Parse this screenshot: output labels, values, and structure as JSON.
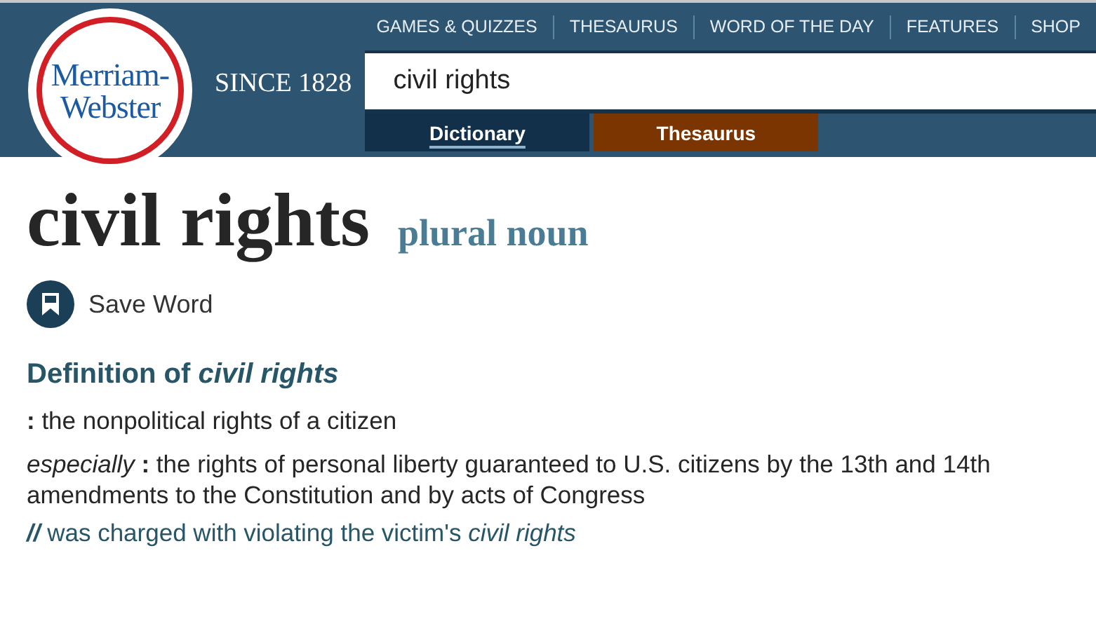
{
  "header": {
    "logo": [
      "Merriam-",
      "Webster"
    ],
    "tagline": "SINCE 1828",
    "nav": [
      "GAMES & QUIZZES",
      "THESAURUS",
      "WORD OF THE DAY",
      "FEATURES",
      "SHOP"
    ],
    "search": {
      "value": "civil rights"
    },
    "tabs": [
      {
        "label": "Dictionary",
        "selected": true,
        "color": "#13304a"
      },
      {
        "label": "Thesaurus",
        "selected": false,
        "color": "#7a3500"
      }
    ]
  },
  "entry": {
    "headword": "civil rights",
    "part_of_speech": "plural noun",
    "save": "Save Word",
    "definition_heading": "Definition of *civil rights*",
    "senses": [
      "**:** the nonpolitical rights of a citizen",
      "*especially* **:** the rights of personal liberty guaranteed to U.S. citizens by the 13th and 14th amendments to the Constitution and by acts of Congress"
    ],
    "example": "**//** was charged with violating the victim's *civil rights*"
  }
}
